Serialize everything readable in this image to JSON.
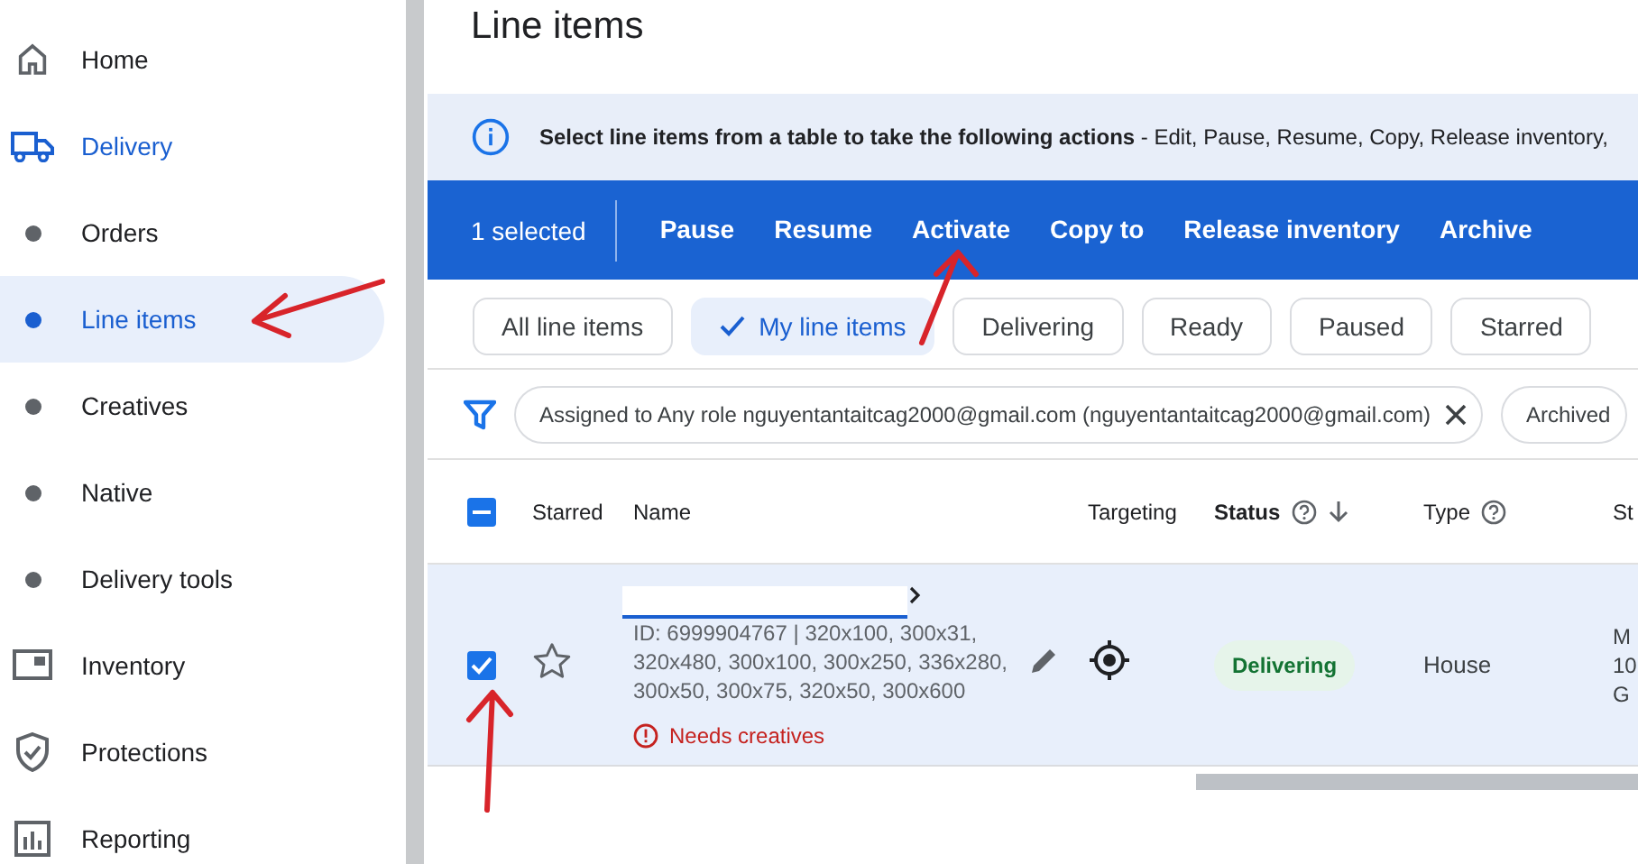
{
  "sidebar": {
    "items": [
      {
        "label": "Home",
        "kind": "section",
        "selected": false
      },
      {
        "label": "Delivery",
        "kind": "section",
        "selected": true
      },
      {
        "label": "Orders",
        "kind": "sub",
        "selected": false
      },
      {
        "label": "Line items",
        "kind": "sub",
        "selected": true
      },
      {
        "label": "Creatives",
        "kind": "sub",
        "selected": false
      },
      {
        "label": "Native",
        "kind": "sub",
        "selected": false
      },
      {
        "label": "Delivery tools",
        "kind": "sub",
        "selected": false
      },
      {
        "label": "Inventory",
        "kind": "section",
        "selected": false
      },
      {
        "label": "Protections",
        "kind": "section",
        "selected": false
      },
      {
        "label": "Reporting",
        "kind": "section",
        "selected": false
      }
    ]
  },
  "page_title": "Line items",
  "info_banner": {
    "text": "**Select line items from a table to take the following actions** - Edit, Pause, Resume, Copy, Release inventory,"
  },
  "action_bar": {
    "count": "1 selected",
    "actions": [
      "Pause",
      "Resume",
      "Activate",
      "Copy to",
      "Release inventory",
      "Archive"
    ]
  },
  "filter_chips": [
    {
      "label": "All line items",
      "selected": false
    },
    {
      "label": "My line items",
      "selected": true
    },
    {
      "label": "Delivering",
      "selected": false
    },
    {
      "label": "Ready",
      "selected": false
    },
    {
      "label": "Paused",
      "selected": false
    },
    {
      "label": "Starred",
      "selected": false
    }
  ],
  "filters": [
    {
      "label": "Assigned to Any role nguyentantaitcag2000@gmail.com (nguyentantaitcag2000@gmail.com)",
      "removable": true
    },
    {
      "label": "Archived",
      "removable": false
    }
  ],
  "table": {
    "header_partial": true,
    "columns": [
      {
        "label": "Starred",
        "bold": false,
        "help": false,
        "sorted": false
      },
      {
        "label": "Name",
        "bold": false,
        "help": false,
        "sorted": false
      },
      {
        "label": "Targeting",
        "bold": false,
        "help": false,
        "sorted": false
      },
      {
        "label": "Status",
        "bold": true,
        "help": true,
        "sorted": true
      },
      {
        "label": "Type",
        "bold": false,
        "help": true,
        "sorted": false
      },
      {
        "label": "St"
      }
    ],
    "rows": [
      {
        "selected": true,
        "starred": false,
        "details": "ID: 6999904767 | 320x100, 300x31, 320x480, 300x100, 300x250, 336x280, 300x50, 300x75, 320x50, 300x600",
        "warning": "Needs creatives",
        "status": "Delivering",
        "type": "House",
        "column_6": [
          "M",
          "10",
          "G"
        ]
      }
    ]
  }
}
